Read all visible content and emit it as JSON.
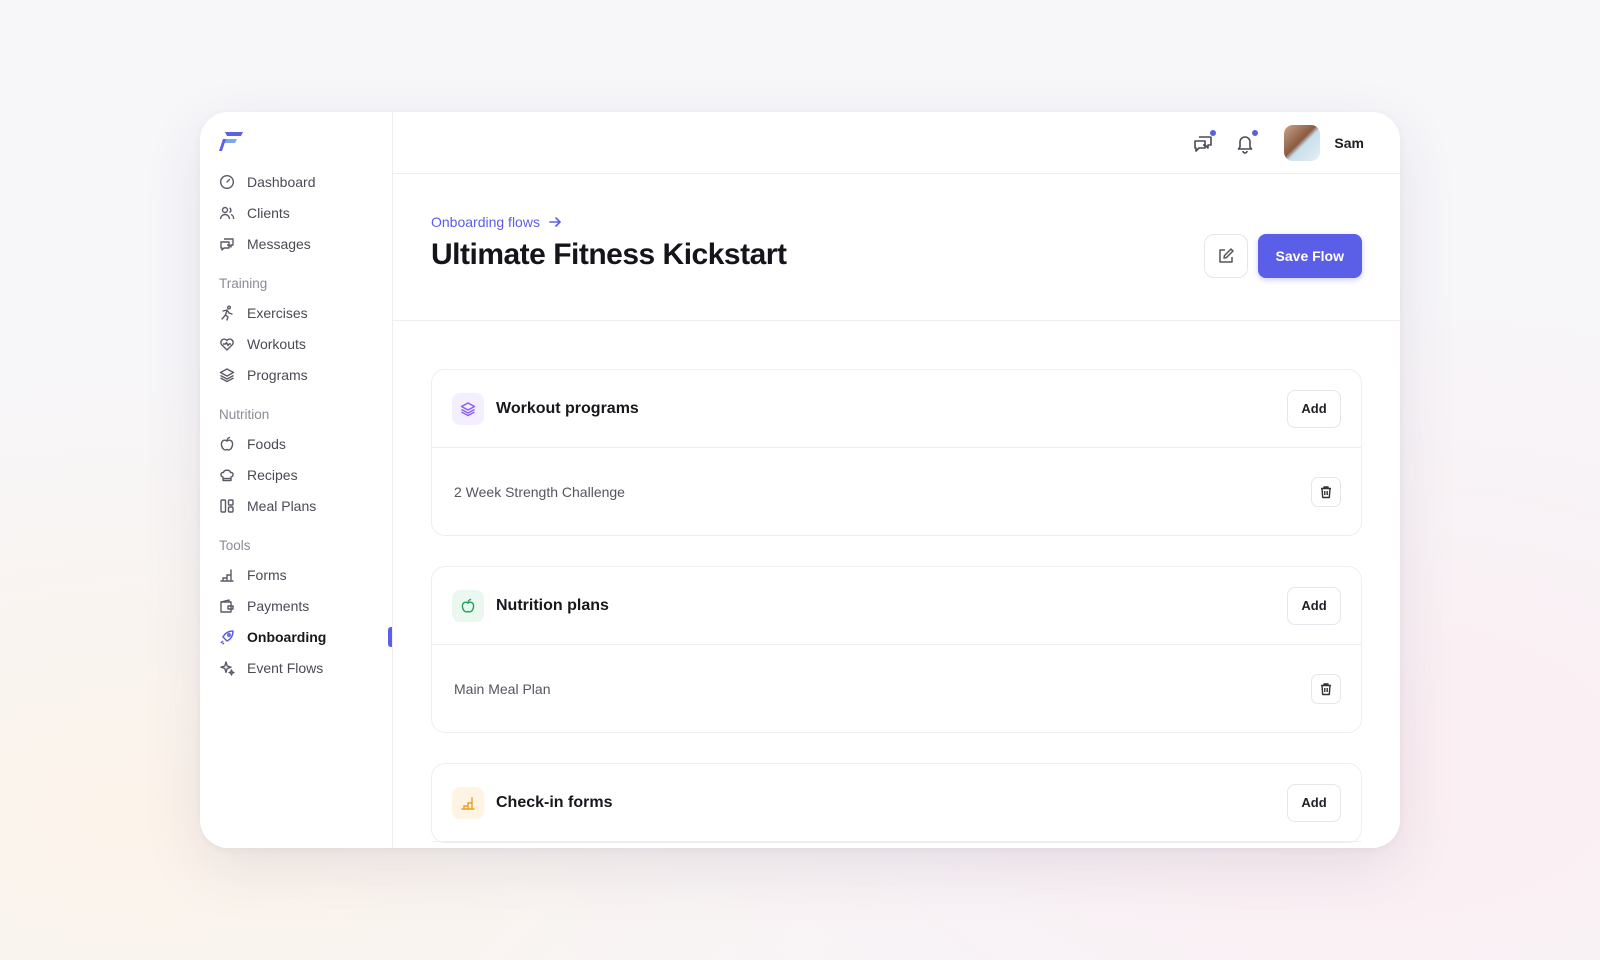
{
  "sidebar": {
    "items_top": [
      {
        "label": "Dashboard",
        "icon": "gauge-icon"
      },
      {
        "label": "Clients",
        "icon": "users-icon"
      },
      {
        "label": "Messages",
        "icon": "chat-icon"
      }
    ],
    "sections": [
      {
        "title": "Training",
        "items": [
          {
            "label": "Exercises",
            "icon": "runner-icon"
          },
          {
            "label": "Workouts",
            "icon": "heart-pulse-icon"
          },
          {
            "label": "Programs",
            "icon": "layers-icon"
          }
        ]
      },
      {
        "title": "Nutrition",
        "items": [
          {
            "label": "Foods",
            "icon": "apple-icon"
          },
          {
            "label": "Recipes",
            "icon": "chef-hat-icon"
          },
          {
            "label": "Meal Plans",
            "icon": "grid-icon"
          }
        ]
      },
      {
        "title": "Tools",
        "items": [
          {
            "label": "Forms",
            "icon": "chart-icon"
          },
          {
            "label": "Payments",
            "icon": "wallet-icon"
          },
          {
            "label": "Onboarding",
            "icon": "rocket-icon",
            "active": true
          },
          {
            "label": "Event Flows",
            "icon": "sparkles-icon"
          }
        ]
      }
    ]
  },
  "topbar": {
    "user_name": "Sam"
  },
  "header": {
    "breadcrumb": "Onboarding flows",
    "title": "Ultimate Fitness Kickstart",
    "save_label": "Save Flow"
  },
  "cards": [
    {
      "title": "Workout programs",
      "add_label": "Add",
      "icon": "layers-icon",
      "accent": "#8b5cf6",
      "tint": "#f4effe",
      "rows": [
        "2 Week Strength Challenge"
      ]
    },
    {
      "title": "Nutrition plans",
      "add_label": "Add",
      "icon": "apple-icon",
      "accent": "#22a35a",
      "tint": "#eaf8ef",
      "rows": [
        "Main Meal Plan"
      ]
    },
    {
      "title": "Check-in forms",
      "add_label": "Add",
      "icon": "chart-icon",
      "accent": "#e8a020",
      "tint": "#fdf4e3",
      "rows": []
    }
  ],
  "colors": {
    "accent": "#5b5ee6"
  }
}
